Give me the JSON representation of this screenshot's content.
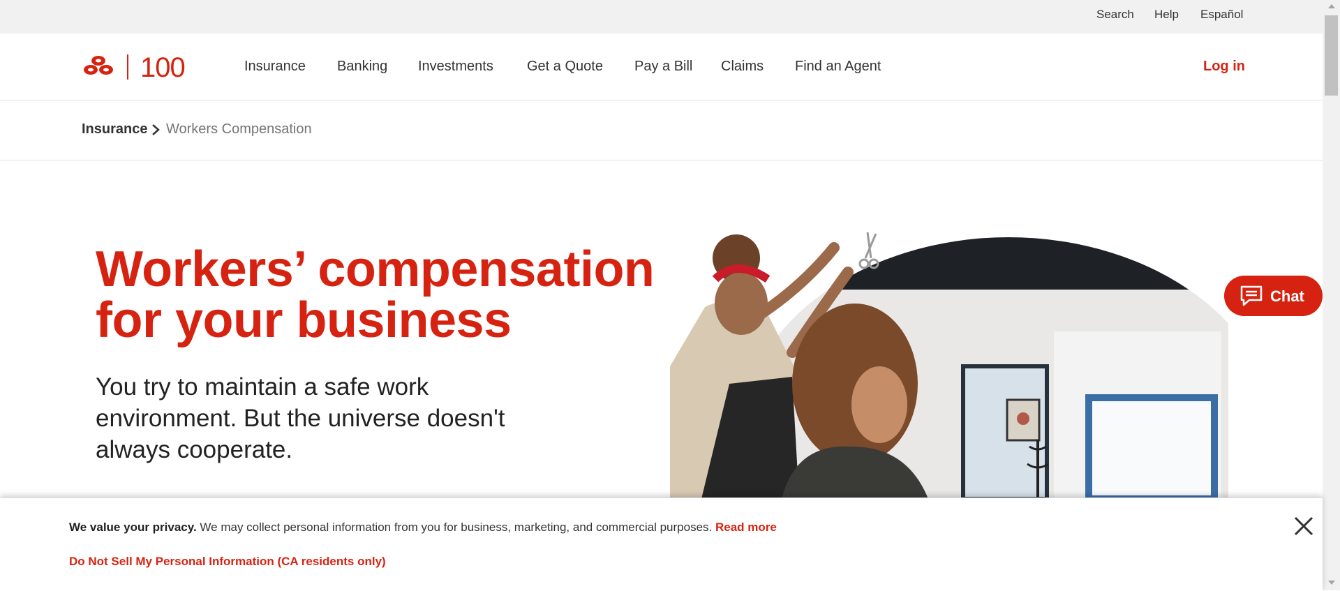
{
  "utility_nav": [
    "Search",
    "Help",
    "Español"
  ],
  "header": {
    "logo_text": "100",
    "nav": [
      "Insurance",
      "Banking",
      "Investments",
      "Get a Quote",
      "Pay a Bill",
      "Claims",
      "Find an Agent"
    ],
    "login": "Log in"
  },
  "breadcrumb": {
    "parent": "Insurance",
    "current": "Workers Compensation"
  },
  "hero": {
    "title": "Workers’ compensation for your business",
    "subtitle": "You try to maintain a safe work environment. But the universe doesn't always cooperate."
  },
  "chat": {
    "label": "Chat",
    "icon": "chat-bubble-icon"
  },
  "privacy": {
    "lead": "We value your privacy.",
    "body": " We may collect personal information from you for business, marketing, and commercial purposes. ",
    "read_more": "Read more",
    "do_not_sell": "Do Not Sell My Personal Information (CA residents only)",
    "close_icon": "close-icon"
  },
  "colors": {
    "brand_red": "#d62311",
    "utility_bg": "#f1f1f1"
  }
}
